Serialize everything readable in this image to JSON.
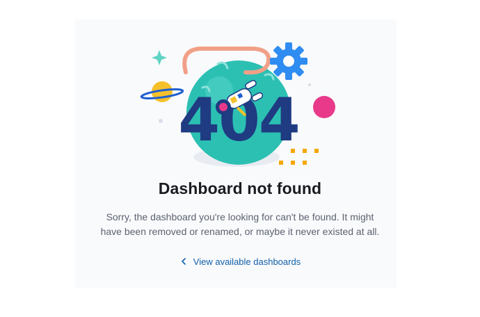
{
  "illustration": {
    "big_text": "404"
  },
  "title": "Dashboard not found",
  "message_lines": [
    "Sorry, the dashboard you're looking for can't be found. It might",
    "have been removed or renamed, or maybe it never existed at all."
  ],
  "link": {
    "label": "View available dashboards",
    "icon": "chevron-left-icon"
  },
  "colors": {
    "title": "#1a1c21",
    "body": "#5a6170",
    "link": "#0f5fa8",
    "big_text": "#1f3b82",
    "planet": "#2cc0b3",
    "gear": "#2f8cf0",
    "pink_ball": "#e8398a",
    "saturn": "#f5c02a",
    "dots": "#f5a700"
  }
}
